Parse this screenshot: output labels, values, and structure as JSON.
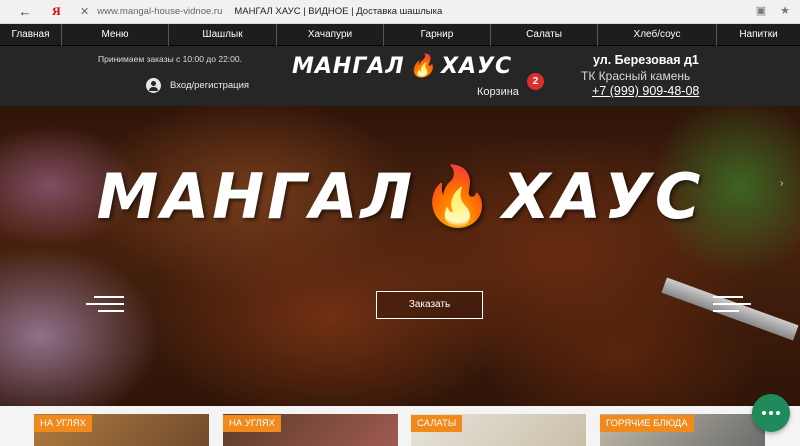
{
  "browser": {
    "back_icon": "arrow-left-icon",
    "yandex": "Я",
    "close": "✕",
    "url": "www.mangal-house-vidnoe.ru",
    "title": "МАНГАЛ ХАУС | ВИДНОЕ | Доставка шашлыка"
  },
  "nav": {
    "items": [
      {
        "label": "Главная"
      },
      {
        "label": "Меню"
      },
      {
        "label": "Шашлык"
      },
      {
        "label": "Хачапури"
      },
      {
        "label": "Гарнир"
      },
      {
        "label": "Салаты"
      },
      {
        "label": "Хлеб/соус"
      },
      {
        "label": "Напитки"
      }
    ]
  },
  "header": {
    "hours": "Принимаем заказы с 10:00 до 22:00.",
    "login": "Вход/регистрация",
    "logo_left": "МАНГАЛ",
    "logo_right": "ХАУС",
    "cart_label": "Корзина",
    "cart_count": "2",
    "address_line1": "ул. Березовая д1",
    "address_line2": "ТК Красный камень",
    "phone": "+7 (999) 909-48-08"
  },
  "hero": {
    "title_left": "МАНГАЛ",
    "title_right": "ХАУС",
    "order_button": "Заказать"
  },
  "categories": [
    {
      "label": "НА УГЛЯХ"
    },
    {
      "label": "НА УГЛЯХ"
    },
    {
      "label": "САЛАТЫ"
    },
    {
      "label": "ГОРЯЧИЕ БЛЮДА"
    }
  ],
  "colors": {
    "accent_orange": "#f08a1c",
    "badge_red": "#d9302c",
    "chat_green": "#1f8a5a",
    "header_dark": "#262626"
  }
}
